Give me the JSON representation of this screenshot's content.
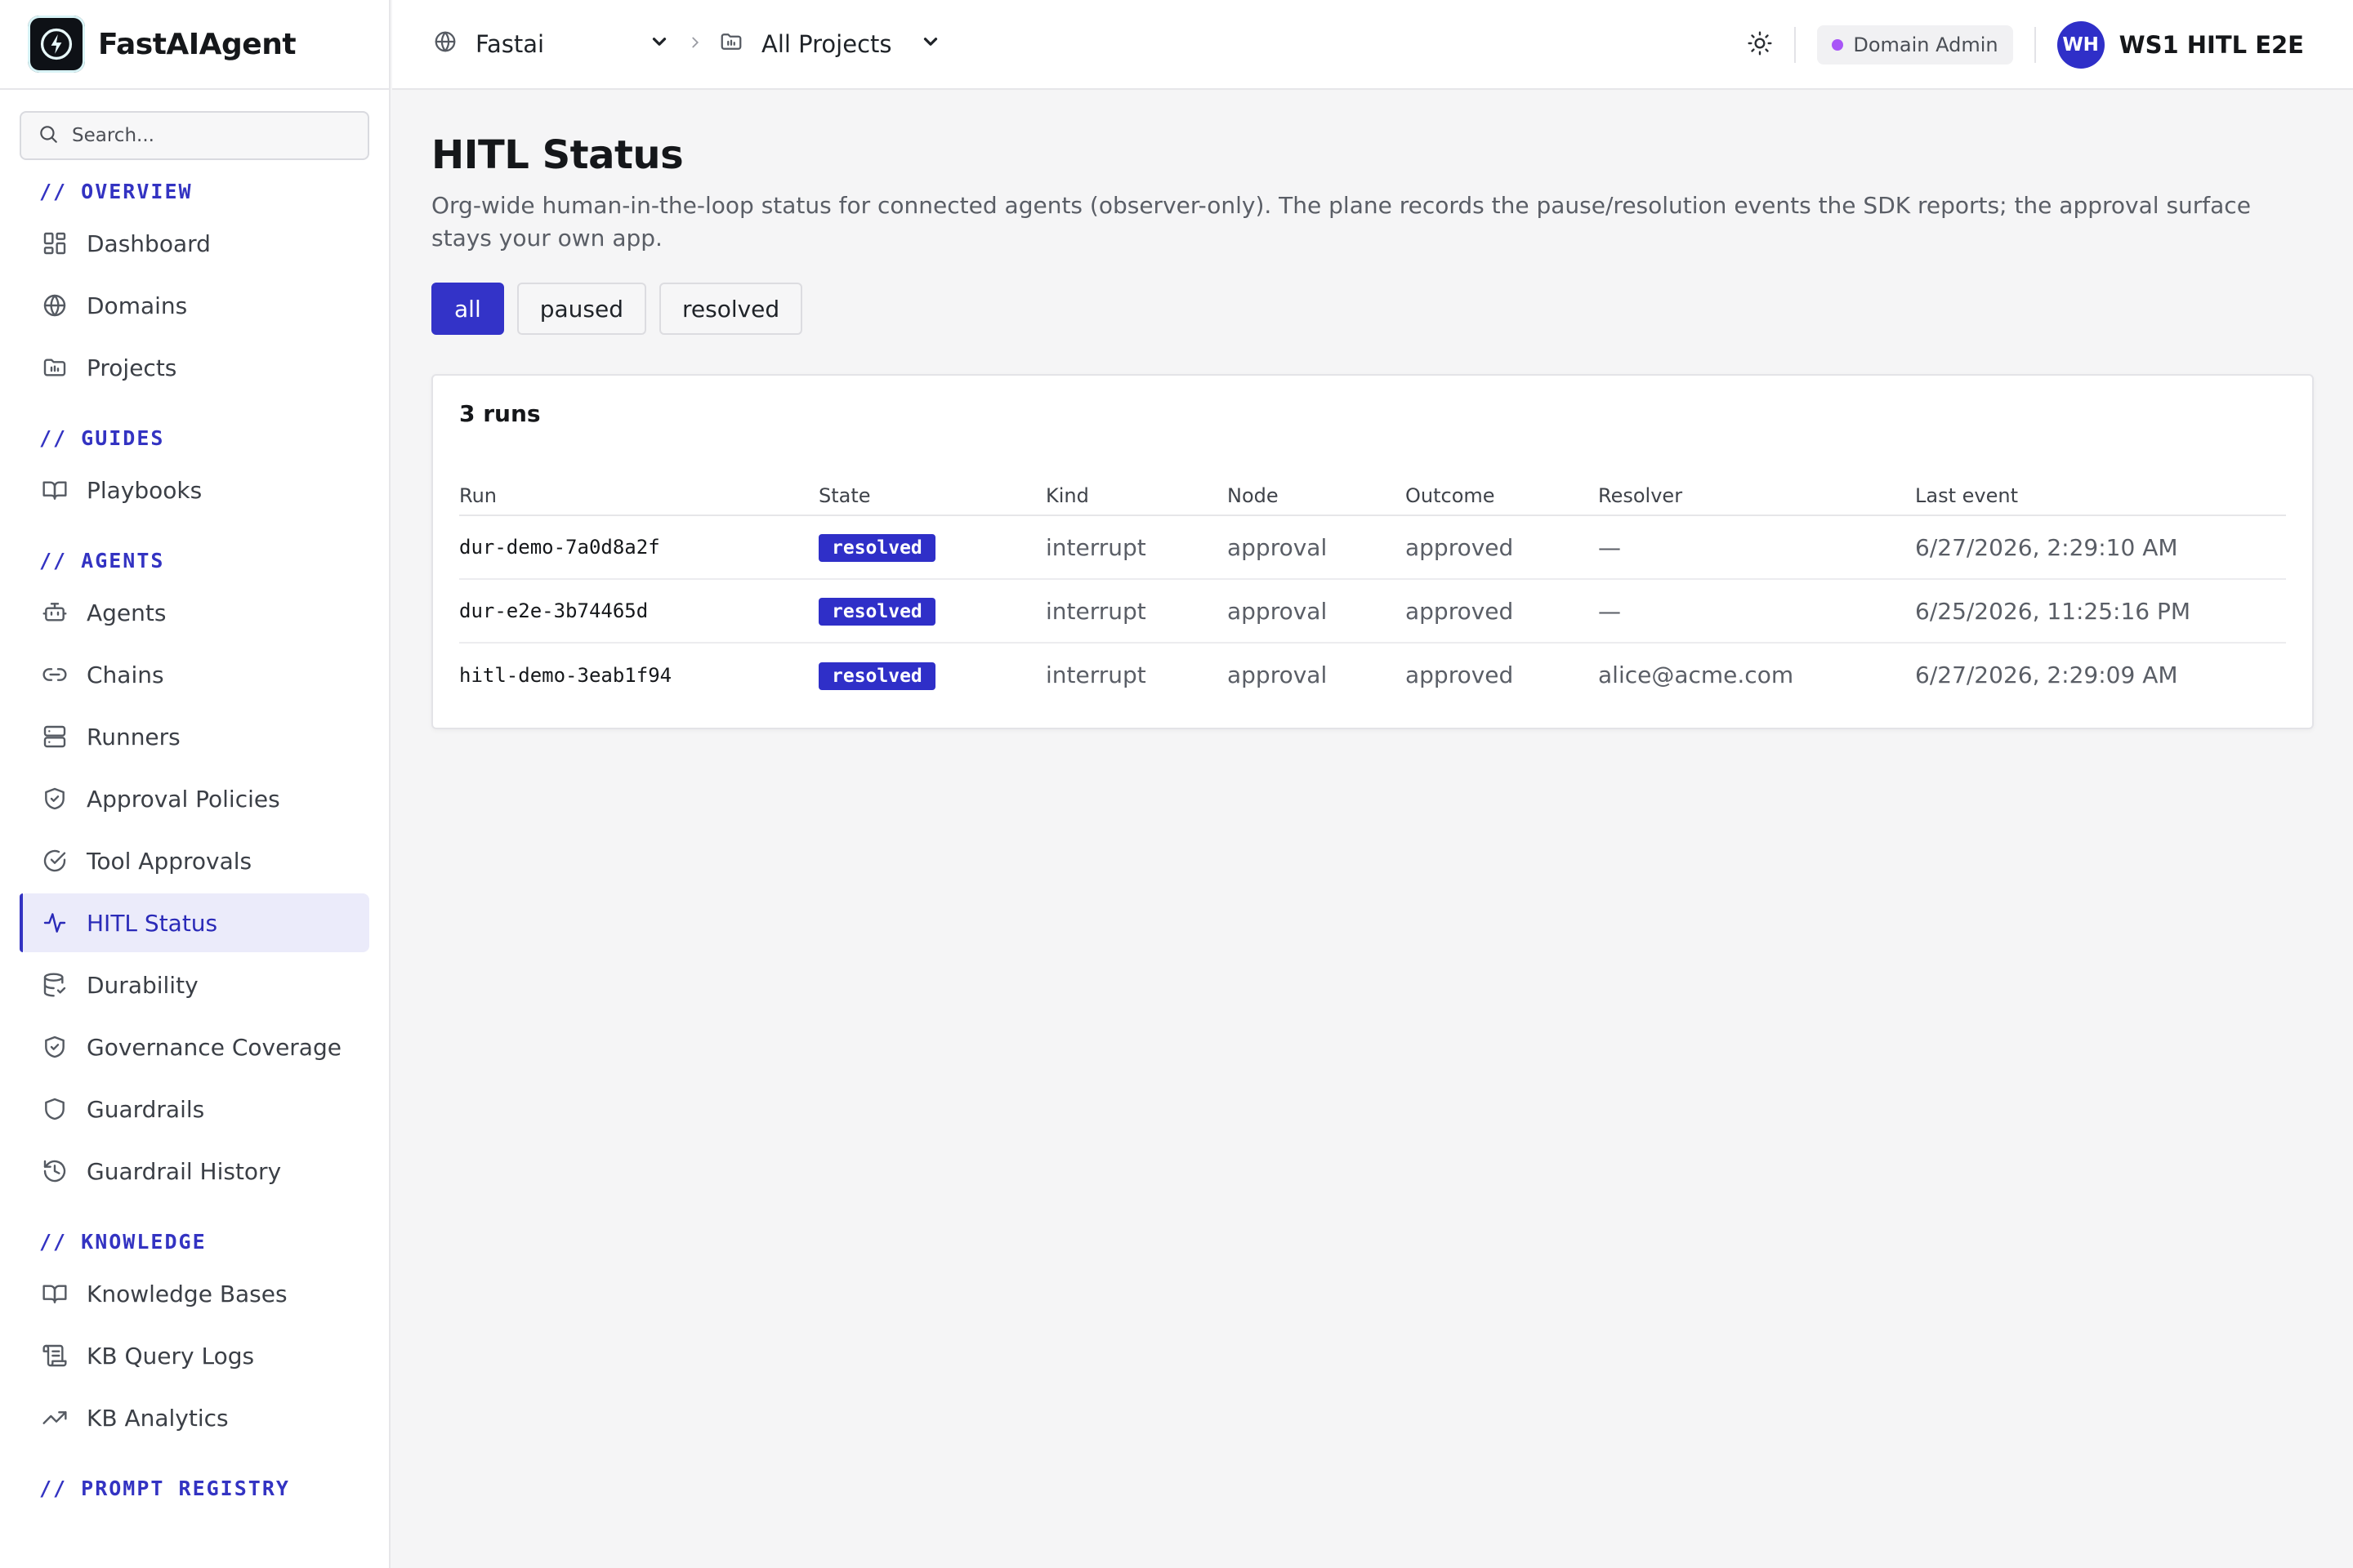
{
  "app": {
    "name": "FastAIAgent"
  },
  "search": {
    "placeholder": "Search..."
  },
  "sidebar": {
    "sections": [
      {
        "title": "// OVERVIEW",
        "items": [
          {
            "label": "Dashboard",
            "icon": "dashboard-icon"
          },
          {
            "label": "Domains",
            "icon": "globe-icon"
          },
          {
            "label": "Projects",
            "icon": "folder-icon"
          }
        ]
      },
      {
        "title": "// GUIDES",
        "items": [
          {
            "label": "Playbooks",
            "icon": "book-icon"
          }
        ]
      },
      {
        "title": "// AGENTS",
        "items": [
          {
            "label": "Agents",
            "icon": "bot-icon"
          },
          {
            "label": "Chains",
            "icon": "link-icon"
          },
          {
            "label": "Runners",
            "icon": "server-icon"
          },
          {
            "label": "Approval Policies",
            "icon": "shield-check-icon"
          },
          {
            "label": "Tool Approvals",
            "icon": "check-circle-icon"
          },
          {
            "label": "HITL Status",
            "icon": "activity-icon",
            "active": true
          },
          {
            "label": "Durability",
            "icon": "database-icon"
          },
          {
            "label": "Governance Coverage",
            "icon": "shield-check-icon"
          },
          {
            "label": "Guardrails",
            "icon": "shield-icon"
          },
          {
            "label": "Guardrail History",
            "icon": "history-icon"
          }
        ]
      },
      {
        "title": "// KNOWLEDGE",
        "items": [
          {
            "label": "Knowledge Bases",
            "icon": "book-icon"
          },
          {
            "label": "KB Query Logs",
            "icon": "scroll-icon"
          },
          {
            "label": "KB Analytics",
            "icon": "trending-up-icon"
          }
        ]
      },
      {
        "title": "// PROMPT REGISTRY",
        "items": []
      }
    ]
  },
  "topbar": {
    "domain": "Fastai",
    "project": "All Projects",
    "role": "Domain Admin",
    "user_initials": "WH",
    "user_name": "WS1 HITL E2E"
  },
  "page": {
    "title": "HITL Status",
    "description": "Org-wide human-in-the-loop status for connected agents (observer-only). The plane records the pause/resolution events the SDK reports; the approval surface stays your own app."
  },
  "filters": [
    {
      "label": "all",
      "active": true
    },
    {
      "label": "paused",
      "active": false
    },
    {
      "label": "resolved",
      "active": false
    }
  ],
  "runs_card": {
    "title": "3 runs",
    "columns": [
      "Run",
      "State",
      "Kind",
      "Node",
      "Outcome",
      "Resolver",
      "Last event"
    ],
    "rows": [
      {
        "run": "dur-demo-7a0d8a2f",
        "state": "resolved",
        "kind": "interrupt",
        "node": "approval",
        "outcome": "approved",
        "resolver": "—",
        "last_event": "6/27/2026, 2:29:10 AM"
      },
      {
        "run": "dur-e2e-3b74465d",
        "state": "resolved",
        "kind": "interrupt",
        "node": "approval",
        "outcome": "approved",
        "resolver": "—",
        "last_event": "6/25/2026, 11:25:16 PM"
      },
      {
        "run": "hitl-demo-3eab1f94",
        "state": "resolved",
        "kind": "interrupt",
        "node": "approval",
        "outcome": "approved",
        "resolver": "alice@acme.com",
        "last_event": "6/27/2026, 2:29:09 AM"
      }
    ]
  },
  "colors": {
    "accent": "#3333c8",
    "role_dot": "#a855f7"
  }
}
